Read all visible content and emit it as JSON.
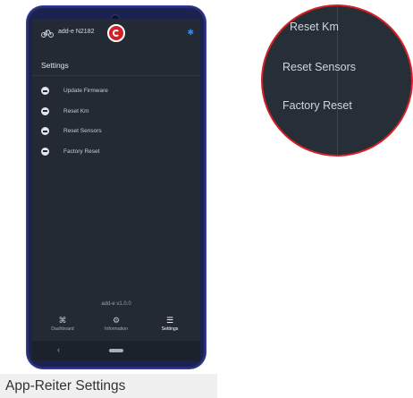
{
  "header": {
    "device_name": "add-e N2182",
    "bluetooth_icon": "bluetooth-icon",
    "bike_icon": "bike-icon"
  },
  "page_title": "Settings",
  "menu": {
    "items": [
      {
        "label": "Update Firmware",
        "icon": "cloud-upload-icon"
      },
      {
        "label": "Reset Km",
        "icon": "reset-icon"
      },
      {
        "label": "Reset Sensors",
        "icon": "minus-circle-icon"
      },
      {
        "label": "Factory Reset",
        "icon": "minus-circle-icon"
      }
    ]
  },
  "version": "add-e v1.0.0",
  "nav": {
    "tabs": [
      {
        "label": "Dashboard",
        "icon": "bike-icon"
      },
      {
        "label": "Information",
        "icon": "gear-icon"
      },
      {
        "label": "Settings",
        "icon": "sliders-icon",
        "active": true
      }
    ]
  },
  "zoom": {
    "items": [
      "Reset Km",
      "Reset Sensors",
      "Factory Reset"
    ]
  },
  "caption": "App-Reiter Settings",
  "colors": {
    "brand_red": "#d51f26",
    "screen_bg": "#232a34",
    "bluetooth": "#2c8cf2",
    "phone_frame": "#1b2250"
  }
}
